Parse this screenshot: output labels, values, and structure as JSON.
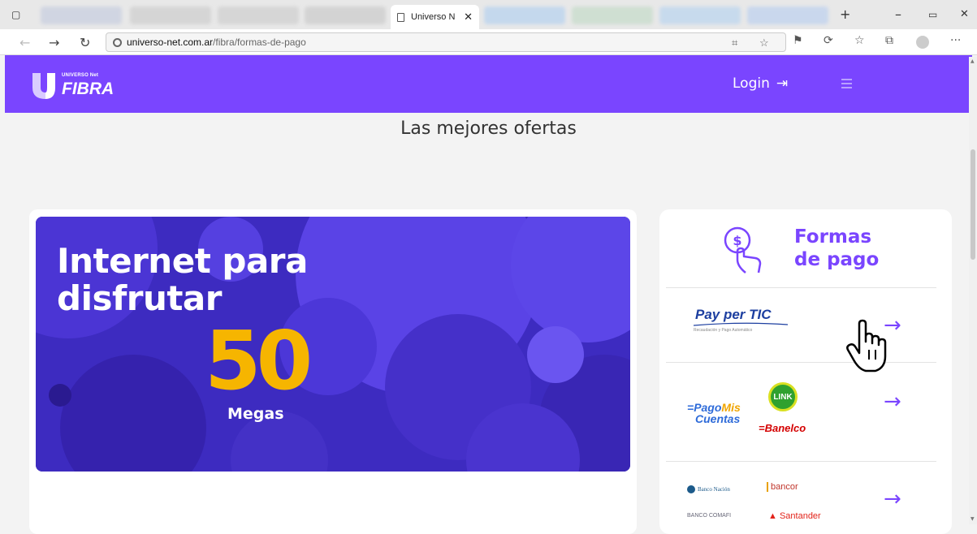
{
  "browser": {
    "active_tab_title": "Universo N",
    "address_host": "universo-net.com.ar",
    "address_path": "/fibra/formas-de-pago",
    "icons": [
      "sidebar-icon",
      "new-tab-icon",
      "minimize-icon",
      "maximize-icon",
      "close-icon",
      "back-icon",
      "forward-icon",
      "refresh-icon",
      "lock-icon",
      "read-aloud-icon",
      "favorite-icon",
      "collections-icon",
      "extensions-icon",
      "profile-icon",
      "more-icon"
    ]
  },
  "header": {
    "logo_small": "UNIVERSO Net",
    "logo_big": "FIBRA",
    "login_label": "Login",
    "brand_color": "#7a45ff"
  },
  "main": {
    "section_title": "Las mejores ofertas",
    "banner": {
      "line1": "Internet para",
      "line2": "disfrutar",
      "speed": "50",
      "unit": "Megas",
      "number_color": "#f6b500"
    },
    "payments": {
      "title_line1": "Formas",
      "title_line2": "de pago",
      "options": [
        {
          "name": "pay-per-tic",
          "label": "Pay per TIC",
          "sub": "Recaudación y Pago Automático"
        },
        {
          "name": "pagomiscuentas-link-banelco",
          "pmc_a": "Pago",
          "pmc_b": "Mis",
          "pmc_c": "Cuentas",
          "link": "LINK",
          "banelco": "Banelco"
        },
        {
          "name": "banks",
          "banco_nacion": "Banco Nación",
          "bancor": "bancor",
          "comafi": "BANCO COMAFI",
          "santander": "Santander"
        }
      ]
    }
  }
}
